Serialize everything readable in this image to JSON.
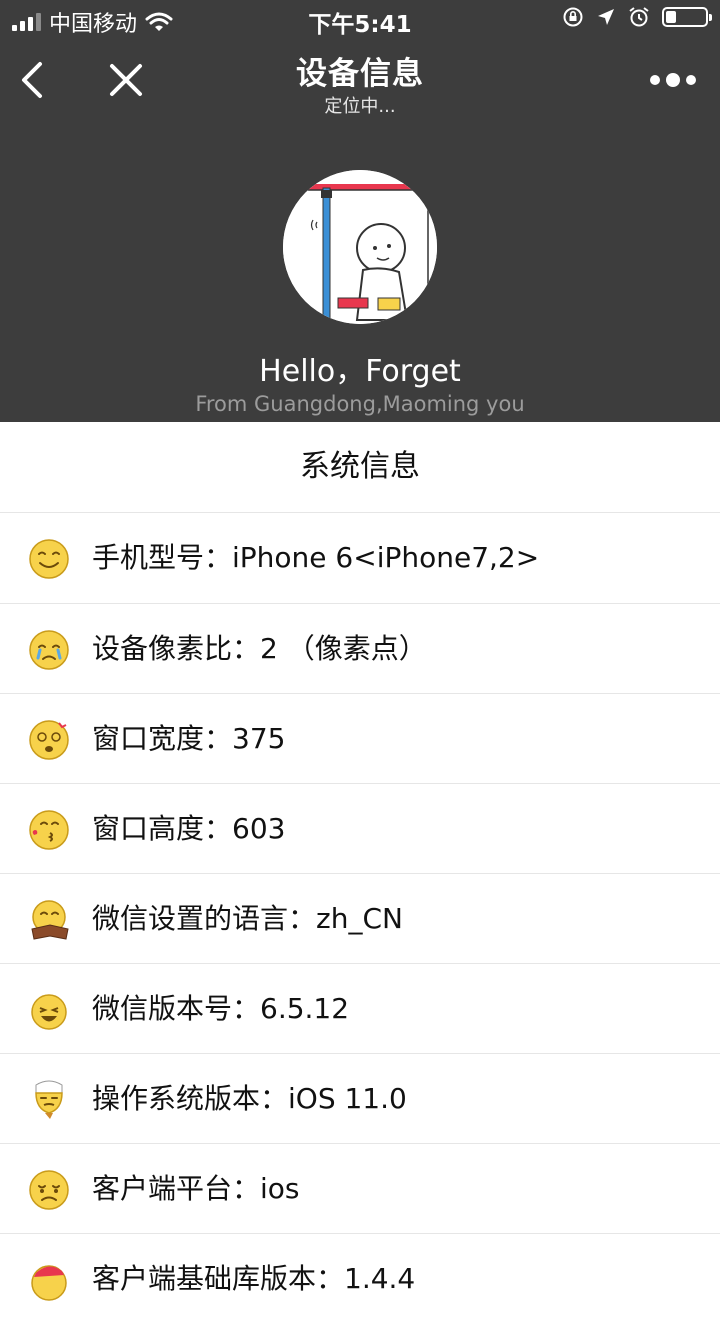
{
  "status_bar": {
    "carrier": "中国移动",
    "time": "下午5:41",
    "battery_level": 0.25,
    "icons": [
      "signal-icon",
      "wifi-icon",
      "rotation-lock-icon",
      "location-arrow-icon",
      "alarm-icon",
      "battery-icon"
    ]
  },
  "nav": {
    "title": "设备信息",
    "subtitle": "定位中...",
    "icons": [
      "back-chevron-icon",
      "close-icon",
      "more-dots-icon"
    ]
  },
  "profile": {
    "greeting": "Hello，Forget",
    "location": "From Guangdong,Maoming you"
  },
  "section_title": "系统信息",
  "rows": [
    {
      "text": "手机型号：iPhone 6<iPhone7,2>",
      "icon": "smile-emoji-icon"
    },
    {
      "text": "设备像素比：2 （像素点）",
      "icon": "crying-emoji-icon"
    },
    {
      "text": "窗口宽度：375",
      "icon": "dizzy-emoji-icon"
    },
    {
      "text": "窗口高度：603",
      "icon": "kiss-emoji-icon"
    },
    {
      "text": "微信设置的语言：zh_CN",
      "icon": "reading-emoji-icon"
    },
    {
      "text": "微信版本号：6.5.12",
      "icon": "laughing-emoji-icon"
    },
    {
      "text": "操作系统版本：iOS 11.0",
      "icon": "bandage-emoji-icon"
    },
    {
      "text": "客户端平台：ios",
      "icon": "sad-emoji-icon"
    },
    {
      "text": "客户端基础库版本：1.4.4",
      "icon": "hat-emoji-icon"
    }
  ],
  "colors": {
    "header_bg": "#3d3d3d",
    "emoji_yellow": "#f7d24b",
    "divider": "#e6e6e6"
  }
}
